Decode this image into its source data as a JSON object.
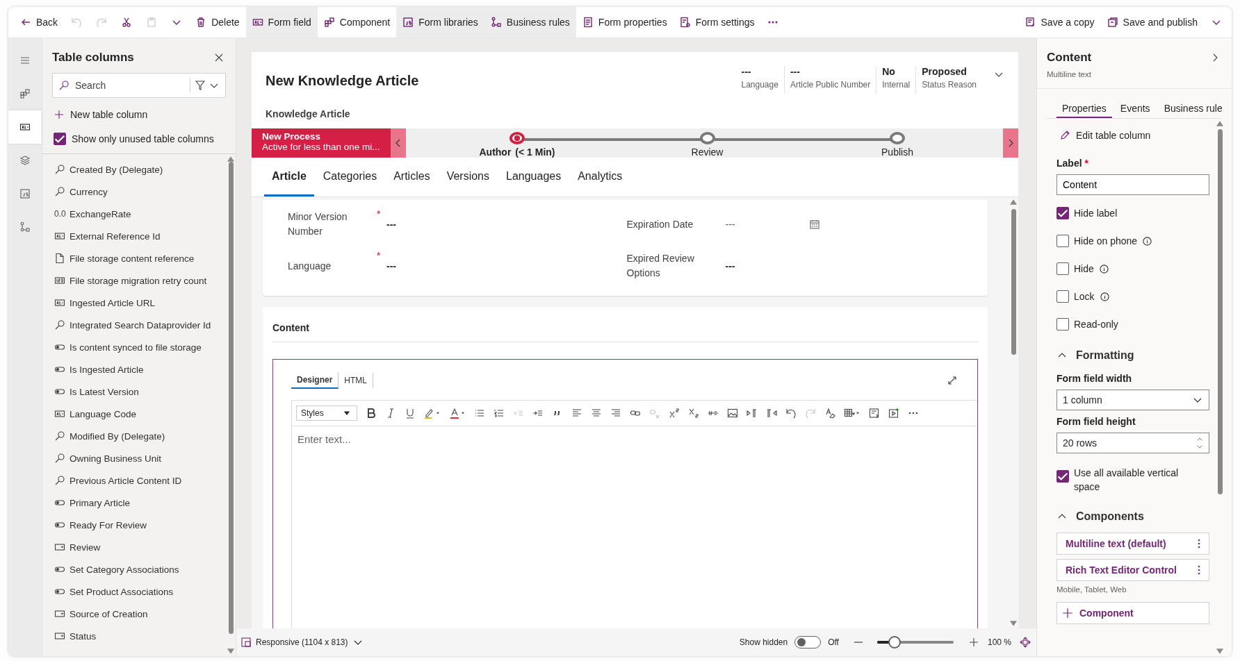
{
  "toolbar": {
    "left": [
      {
        "kind": "back",
        "label": "Back",
        "selected": false,
        "disabled": false
      },
      {
        "kind": "undo",
        "disabled": true
      },
      {
        "kind": "redo",
        "disabled": true
      },
      {
        "kind": "cut",
        "disabled": false
      },
      {
        "kind": "paste",
        "disabled": true
      },
      {
        "kind": "chevron",
        "disabled": false
      },
      {
        "kind": "delete",
        "label": "Delete",
        "selected": false,
        "disabled": false
      },
      {
        "kind": "field",
        "label": "Form field",
        "selected": true,
        "disabled": false
      },
      {
        "kind": "component",
        "label": "Component",
        "selected": false,
        "disabled": false
      },
      {
        "kind": "js",
        "label": "Form libraries",
        "selected": true,
        "disabled": false
      },
      {
        "kind": "rules",
        "label": "Business rules",
        "selected": true,
        "disabled": false
      },
      {
        "kind": "props",
        "label": "Form properties",
        "selected": false,
        "disabled": false
      },
      {
        "kind": "settings",
        "label": "Form settings",
        "selected": false,
        "disabled": false
      },
      {
        "kind": "more",
        "disabled": false
      }
    ],
    "right": [
      {
        "kind": "savecopy",
        "label": "Save a copy",
        "selected": false,
        "disabled": false
      },
      {
        "kind": "publish",
        "label": "Save and publish",
        "selected": false,
        "disabled": false
      },
      {
        "kind": "chevron",
        "disabled": false
      }
    ]
  },
  "rail": [
    {
      "kind": "menu",
      "selected": false
    },
    {
      "kind": "component",
      "selected": false
    },
    {
      "kind": "field",
      "selected": true
    },
    {
      "kind": "layers",
      "selected": false
    },
    {
      "kind": "js",
      "selected": false
    },
    {
      "kind": "rules",
      "selected": false
    }
  ],
  "left_panel": {
    "title": "Table columns",
    "search": {
      "placeholder": "Search"
    },
    "new_column": "New table column",
    "show_unused": {
      "label": "Show only unused table columns",
      "checked": true
    },
    "columns": [
      {
        "kind": "lookup",
        "name": "Created By (Delegate)"
      },
      {
        "kind": "lookup",
        "name": "Currency"
      },
      {
        "kind": "decimal",
        "glyph": "0.0",
        "name": "ExchangeRate"
      },
      {
        "kind": "text",
        "name": "External Reference Id"
      },
      {
        "kind": "file",
        "name": "File storage content reference"
      },
      {
        "kind": "number",
        "name": "File storage migration retry count"
      },
      {
        "kind": "text",
        "name": "Ingested Article URL"
      },
      {
        "kind": "lookup",
        "name": "Integrated Search Dataprovider Id"
      },
      {
        "kind": "toggle",
        "name": "Is content synced to file storage"
      },
      {
        "kind": "toggle",
        "name": "Is Ingested Article"
      },
      {
        "kind": "toggle",
        "name": "Is Latest Version"
      },
      {
        "kind": "text",
        "name": "Language Code"
      },
      {
        "kind": "lookup",
        "name": "Modified By (Delegate)"
      },
      {
        "kind": "lookup",
        "name": "Owning Business Unit"
      },
      {
        "kind": "lookup",
        "name": "Previous Article Content ID"
      },
      {
        "kind": "toggle",
        "name": "Primary Article"
      },
      {
        "kind": "toggle",
        "name": "Ready For Review"
      },
      {
        "kind": "choice",
        "name": "Review"
      },
      {
        "kind": "toggle",
        "name": "Set Category Associations"
      },
      {
        "kind": "toggle",
        "name": "Set Product Associations"
      },
      {
        "kind": "choice",
        "name": "Source of Creation"
      },
      {
        "kind": "choice",
        "name": "Status"
      }
    ]
  },
  "form": {
    "title": "New Knowledge Article",
    "entity": "Knowledge Article",
    "header_fields": [
      {
        "value": "---",
        "label": "Language"
      },
      {
        "value": "---",
        "label": "Article Public Number"
      },
      {
        "value": "No",
        "label": "Internal"
      },
      {
        "value": "Proposed",
        "label": "Status Reason"
      }
    ],
    "process": {
      "name": "New Process",
      "status": "Active for less than one mi...",
      "stages": [
        {
          "label": "Author",
          "duration": "(< 1 Min)",
          "selected": true
        },
        {
          "label": "Review",
          "selected": false
        },
        {
          "label": "Publish",
          "selected": false
        }
      ]
    },
    "tabs": [
      {
        "label": "Article",
        "selected": true
      },
      {
        "label": "Categories",
        "selected": false
      },
      {
        "label": "Articles",
        "selected": false
      },
      {
        "label": "Versions",
        "selected": false
      },
      {
        "label": "Languages",
        "selected": false
      },
      {
        "label": "Analytics",
        "selected": false
      }
    ],
    "fields_left": [
      {
        "label": "Minor Version Number",
        "required_mark": "*",
        "value": "---"
      },
      {
        "label": "Language",
        "required_mark": "*",
        "value": "---"
      }
    ],
    "fields_right": [
      {
        "label": "Expiration Date",
        "value": "---",
        "kind": "date"
      },
      {
        "label": "Expired Review Options",
        "value": "---",
        "kind": "text"
      }
    ],
    "content": {
      "title": "Content",
      "editor_tabs": [
        {
          "label": "Designer",
          "selected": true
        },
        {
          "label": "HTML",
          "selected": false
        }
      ],
      "styles": "Styles",
      "tools": [
        {
          "kind": "bold",
          "disabled": false
        },
        {
          "kind": "italic",
          "disabled": false
        },
        {
          "kind": "underline",
          "disabled": false
        },
        {
          "kind": "highlight",
          "disabled": false
        },
        {
          "kind": "fontcolor",
          "disabled": false
        },
        {
          "kind": "bullets",
          "disabled": false
        },
        {
          "kind": "numbers",
          "disabled": false
        },
        {
          "kind": "outdent",
          "disabled": true
        },
        {
          "kind": "indent",
          "disabled": false
        },
        {
          "kind": "quote",
          "disabled": false
        },
        {
          "kind": "alignleft",
          "disabled": false
        },
        {
          "kind": "aligncenter",
          "disabled": false
        },
        {
          "kind": "alignright",
          "disabled": false
        },
        {
          "kind": "link",
          "disabled": false
        },
        {
          "kind": "unlink",
          "disabled": true
        },
        {
          "kind": "sup",
          "disabled": false
        },
        {
          "kind": "sub",
          "disabled": false
        },
        {
          "kind": "strike",
          "disabled": false
        },
        {
          "kind": "image",
          "disabled": false
        },
        {
          "kind": "ltr",
          "disabled": false
        },
        {
          "kind": "rtl",
          "disabled": false
        },
        {
          "kind": "undo",
          "disabled": false
        },
        {
          "kind": "redo",
          "disabled": true
        },
        {
          "kind": "clear",
          "disabled": false
        },
        {
          "kind": "table",
          "disabled": false
        },
        {
          "kind": "source",
          "disabled": false
        },
        {
          "kind": "media",
          "disabled": false
        },
        {
          "kind": "more",
          "disabled": false
        }
      ],
      "placeholder": "Enter text..."
    }
  },
  "bottom_bar": {
    "layout": "Responsive (1104 x 813)",
    "show_hidden": {
      "label": "Show hidden",
      "on": false,
      "state_text": "Off"
    },
    "zoom": {
      "level": 0.23,
      "reading": "100 %"
    }
  },
  "right_panel": {
    "title": "Content",
    "subtitle": "Multiline text",
    "tabs": [
      {
        "label": "Properties",
        "selected": true
      },
      {
        "label": "Events",
        "selected": false
      },
      {
        "label": "Business rule",
        "selected": false
      }
    ],
    "edit_link": "Edit table column",
    "label_field": {
      "label": "Label",
      "required_mark": "*",
      "value": "Content"
    },
    "options": [
      {
        "label": "Hide label",
        "checked": true,
        "info": false
      },
      {
        "label": "Hide on phone",
        "checked": false,
        "info": true
      },
      {
        "label": "Hide",
        "checked": false,
        "info": true
      },
      {
        "label": "Lock",
        "checked": false,
        "info": true
      },
      {
        "label": "Read-only",
        "checked": false,
        "info": false
      }
    ],
    "formatting": {
      "title": "Formatting",
      "expanded": true,
      "width_label": "Form field width",
      "width_value": "1 column",
      "height_label": "Form field height",
      "height_value": "20 rows",
      "use_all": {
        "label": "Use all available vertical space",
        "checked": true
      }
    },
    "components": {
      "title": "Components",
      "expanded": true,
      "items": [
        {
          "label": "Multiline text (default)"
        },
        {
          "label": "Rich Text Editor Control",
          "note": "Mobile, Tablet, Web"
        }
      ],
      "add": "Component"
    }
  }
}
